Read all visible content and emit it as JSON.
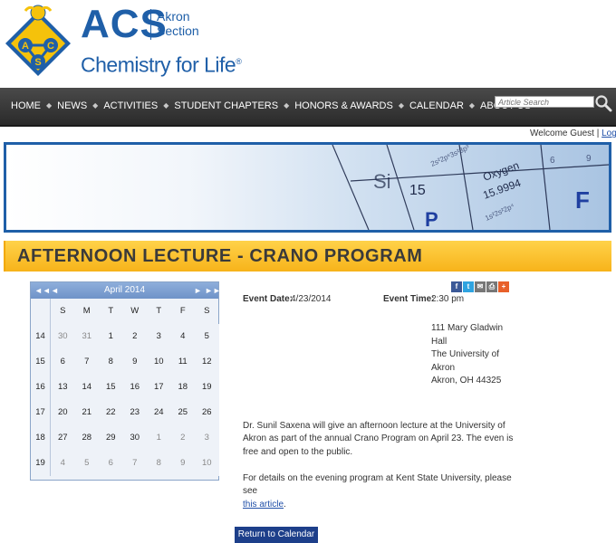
{
  "header": {
    "logo_acs": "ACS",
    "logo_section_line1": "Akron",
    "logo_section_line2": "Section",
    "logo_tagline": "Chemistry for Life",
    "logo_reg": "®",
    "emblem_letters": [
      "A",
      "C",
      "S"
    ]
  },
  "nav": {
    "items": [
      "HOME",
      "NEWS",
      "ACTIVITIES",
      "STUDENT CHAPTERS",
      "HONORS & AWARDS",
      "CALENDAR",
      "ABOUT US"
    ],
    "separator": "◆",
    "search_placeholder": "Article Search"
  },
  "welcome": {
    "text": "Welcome Guest | ",
    "login_label": "Log In"
  },
  "banner": {
    "element_labels": [
      "Si",
      "15",
      "Oxygen",
      "15.9994",
      "P",
      "F"
    ]
  },
  "page_title": "AFTERNOON LECTURE - CRANO PROGRAM",
  "calendar": {
    "month_label": "April 2014",
    "nav_prev_year": "◄◄",
    "nav_prev": "◄",
    "nav_next": "►",
    "nav_next_year": "►►",
    "day_headers": [
      "S",
      "M",
      "T",
      "W",
      "T",
      "F",
      "S"
    ],
    "weeks": [
      {
        "week": "14",
        "days": [
          "30",
          "31",
          "1",
          "2",
          "3",
          "4",
          "5"
        ],
        "other": [
          true,
          true,
          false,
          false,
          false,
          false,
          false
        ]
      },
      {
        "week": "15",
        "days": [
          "6",
          "7",
          "8",
          "9",
          "10",
          "11",
          "12"
        ],
        "other": [
          false,
          false,
          false,
          false,
          false,
          false,
          false
        ]
      },
      {
        "week": "16",
        "days": [
          "13",
          "14",
          "15",
          "16",
          "17",
          "18",
          "19"
        ],
        "other": [
          false,
          false,
          false,
          false,
          false,
          false,
          false
        ]
      },
      {
        "week": "17",
        "days": [
          "20",
          "21",
          "22",
          "23",
          "24",
          "25",
          "26"
        ],
        "other": [
          false,
          false,
          false,
          false,
          false,
          false,
          false
        ]
      },
      {
        "week": "18",
        "days": [
          "27",
          "28",
          "29",
          "30",
          "1",
          "2",
          "3"
        ],
        "other": [
          false,
          false,
          false,
          false,
          true,
          true,
          true
        ]
      },
      {
        "week": "19",
        "days": [
          "4",
          "5",
          "6",
          "7",
          "8",
          "9",
          "10"
        ],
        "other": [
          true,
          true,
          true,
          true,
          true,
          true,
          true
        ]
      }
    ],
    "selected_day": "23"
  },
  "social": {
    "icons": [
      "facebook-icon",
      "twitter-icon",
      "email-icon",
      "print-icon",
      "share-plus-icon"
    ],
    "colors": [
      "#3b5998",
      "#2fa3e0",
      "#777777",
      "#777777",
      "#e8602a"
    ]
  },
  "event": {
    "date_label": "Event Date:",
    "date_value": "4/23/2014",
    "time_label": "Event Time:",
    "time_value": "2:30 pm",
    "address_lines": [
      "111 Mary Gladwin",
      "Hall",
      "The University of",
      "Akron",
      "Akron, OH 44325"
    ],
    "description": "Dr. Sunil Saxena will give an afternoon lecture at the University of Akron as part of the annual Crano Program on April 23. The even is free and open to the public.",
    "details_text": "For details on the evening program at Kent State University, please see",
    "article_link": "this article",
    "details_suffix": "."
  },
  "return_button": "Return to Calendar",
  "colors": {
    "brand_blue": "#1f5fa8",
    "title_bar_gold": "#f7b31a",
    "nav_dark": "#333333",
    "button_blue": "#1d3f8a",
    "calendar_selected": "#cfc9a3"
  }
}
